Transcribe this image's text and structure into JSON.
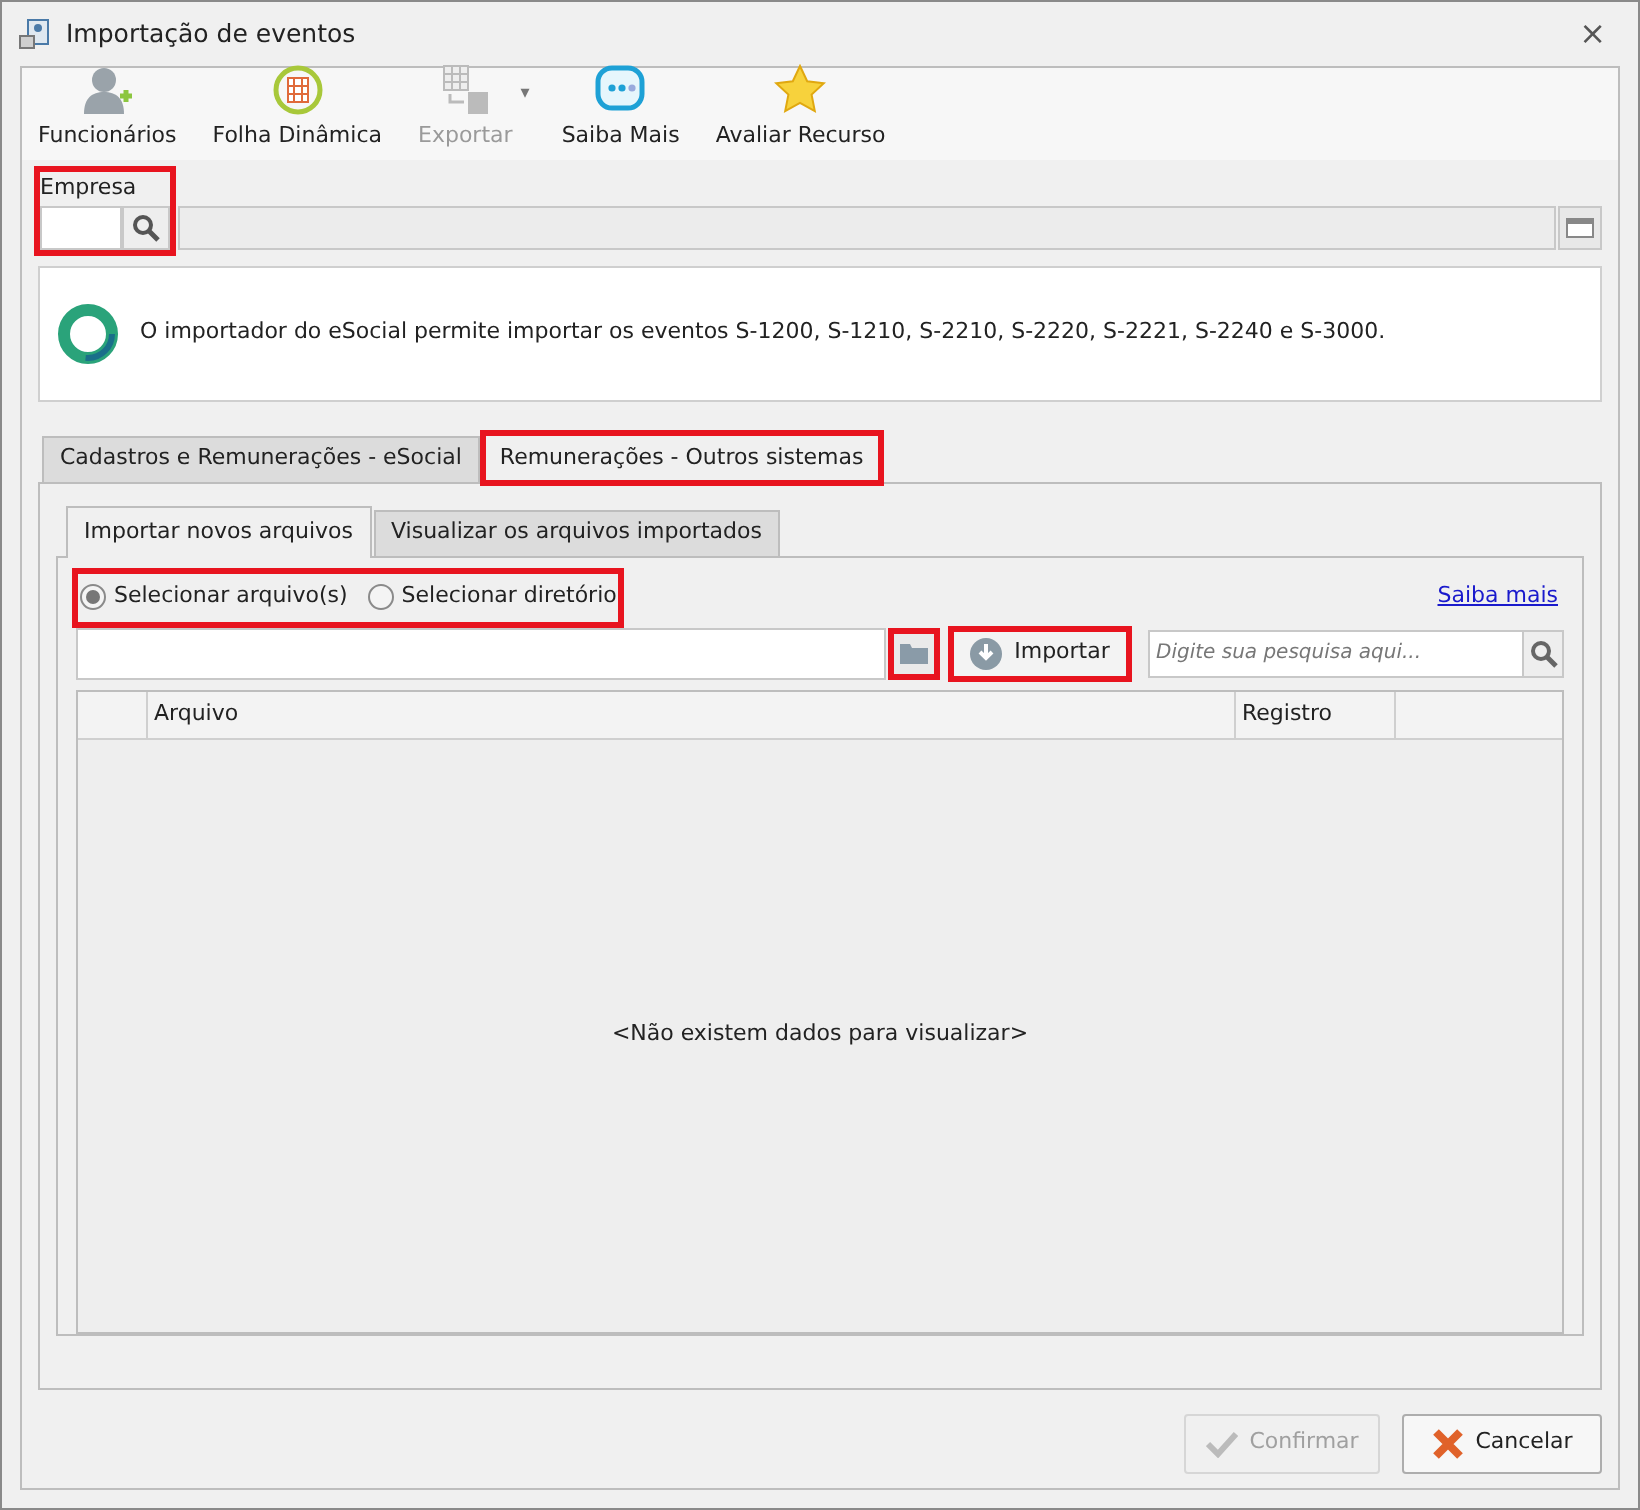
{
  "window": {
    "title": "Importação de eventos",
    "close": "×"
  },
  "toolbar": [
    {
      "label": "Funcionários",
      "kind": "person",
      "disabled": false
    },
    {
      "label": "Folha Dinâmica",
      "kind": "sheet",
      "disabled": false
    },
    {
      "label": "Exportar",
      "kind": "export",
      "disabled": true,
      "dropdown": "▾"
    },
    {
      "label": "Saiba Mais",
      "kind": "chat",
      "disabled": false
    },
    {
      "label": "Avaliar Recurso",
      "kind": "star",
      "disabled": false
    }
  ],
  "empresa": {
    "label": "Empresa",
    "highlighted": true
  },
  "info": {
    "text": "O importador do eSocial permite importar os eventos S-1200, S-1210, S-2210, S-2220, S-2221, S-2240 e S-3000."
  },
  "tabs": [
    {
      "label": "Cadastros e Remunerações - eSocial",
      "selected": false,
      "highlighted": false
    },
    {
      "label": "Remunerações - Outros sistemas",
      "selected": true,
      "highlighted": true
    }
  ],
  "subtabs": [
    {
      "label": "Importar novos arquivos",
      "selected": true
    },
    {
      "label": "Visualizar os arquivos importados",
      "selected": false
    }
  ],
  "source": {
    "highlighted": true,
    "options": [
      {
        "label": "Selecionar arquivo(s)",
        "selected": true
      },
      {
        "label": "Selecionar diretório",
        "selected": false
      }
    ]
  },
  "link": "Saiba mais",
  "folder_button": {
    "highlighted": true
  },
  "import_button": {
    "label": "Importar",
    "highlighted": true
  },
  "search": {
    "placeholder": "Digite sua pesquisa aqui..."
  },
  "table": {
    "columns": [
      "Arquivo",
      "Registro"
    ],
    "empty": "<Não existem dados para visualizar>"
  },
  "buttons": [
    {
      "label": "Confirmar",
      "kind": "confirm",
      "disabled": true
    },
    {
      "label": "Cancelar",
      "kind": "cancel",
      "disabled": false
    }
  ]
}
